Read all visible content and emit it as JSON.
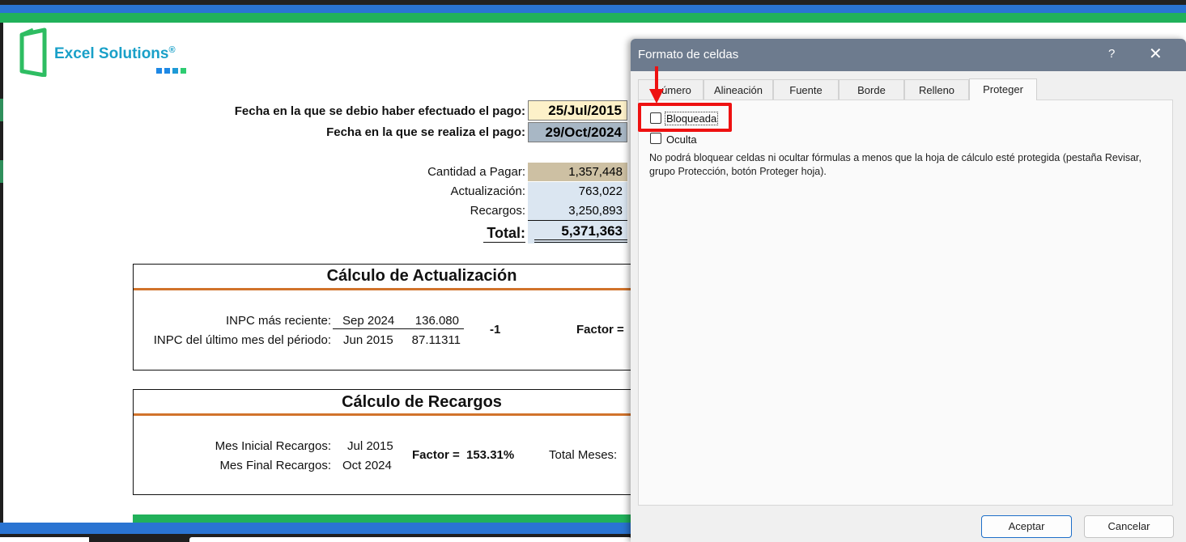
{
  "logo": {
    "text": "Excel Solutions",
    "reg": "®",
    "dot_colors": [
      "#1e88e5",
      "#1e88e5",
      "#1e9ad6",
      "#2ecc71"
    ],
    "brand_color": "#19a0c8"
  },
  "payment": {
    "due_label": "Fecha en la que se debio haber efectuado el pago:",
    "due_value": "25/Jul/2015",
    "paid_label": "Fecha en la que se realiza el pago:",
    "paid_value": "29/Oct/2024"
  },
  "amounts": {
    "cantidad_label": "Cantidad a Pagar:",
    "cantidad_value": "1,357,448",
    "actualizacion_label": "Actualización:",
    "actualizacion_value": "763,022",
    "recargos_label": "Recargos:",
    "recargos_value": "3,250,893",
    "total_label": "Total:",
    "total_value": "5,371,363"
  },
  "actualizacion_box": {
    "title": "Cálculo de Actualización",
    "inpc_recent_label": "INPC más reciente:",
    "inpc_recent_month": "Sep 2024",
    "inpc_recent_value": "136.080",
    "inpc_last_label": "INPC del último mes del périodo:",
    "inpc_last_month": "Jun 2015",
    "inpc_last_value": "87.11311",
    "minus_one": "-1",
    "factor_label": "Factor ="
  },
  "recargos_box": {
    "title": "Cálculo de Recargos",
    "mes_inicial_label": "Mes Inicial Recargos:",
    "mes_inicial_value": "Jul 2015",
    "mes_final_label": "Mes Final Recargos:",
    "mes_final_value": "Oct 2024",
    "factor_label": "Factor =",
    "factor_value": "153.31%",
    "total_meses_label": "Total Meses:"
  },
  "dialog": {
    "title": "Formato de celdas",
    "help": "?",
    "close": "✕",
    "tabs": [
      "Número",
      "Alineación",
      "Fuente",
      "Borde",
      "Relleno",
      "Proteger"
    ],
    "tab_visible_first": "úmero",
    "active_tab": "Proteger",
    "checkboxes": [
      {
        "label": "Bloqueada",
        "checked": false
      },
      {
        "label": "Oculta",
        "checked": false
      }
    ],
    "description": "No podrá bloquear celdas ni ocultar fórmulas a menos que la hoja de cálculo esté protegida (pestaña Revisar, grupo Protección, botón Proteger hoja).",
    "ok_label": "Aceptar",
    "cancel_label": "Cancelar"
  },
  "annotation": {
    "color": "#ee1111"
  }
}
